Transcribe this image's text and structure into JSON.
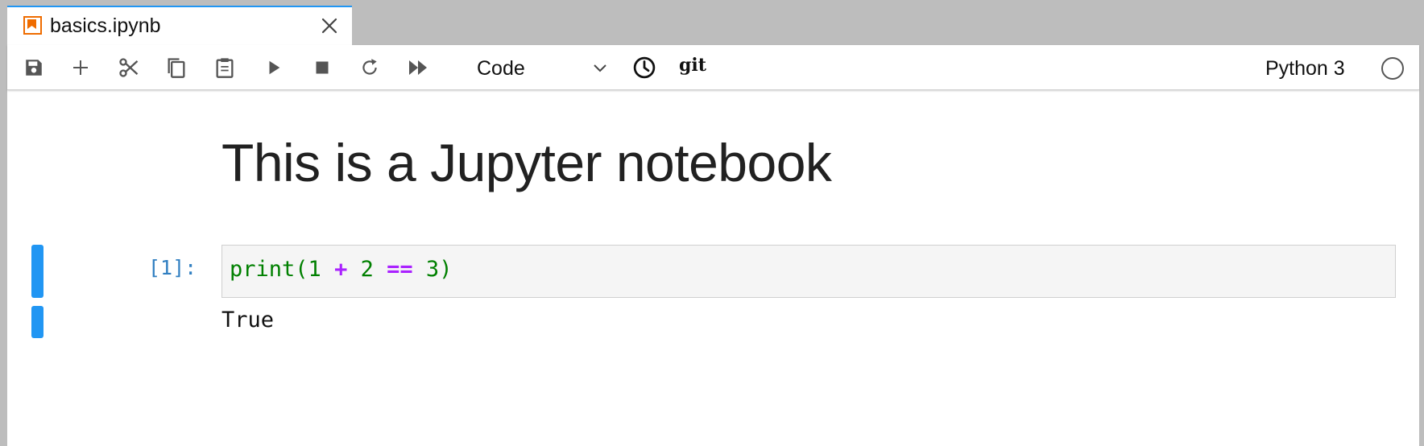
{
  "tab": {
    "title": "basics.ipynb",
    "icon": "notebook-icon",
    "accent": "#ef6c00"
  },
  "toolbar": {
    "buttons": [
      {
        "name": "save-icon"
      },
      {
        "name": "add-cell-icon"
      },
      {
        "name": "cut-icon"
      },
      {
        "name": "copy-icon"
      },
      {
        "name": "paste-icon"
      },
      {
        "name": "run-icon"
      },
      {
        "name": "stop-icon"
      },
      {
        "name": "restart-icon"
      },
      {
        "name": "run-all-icon"
      }
    ],
    "cell_type": "Code",
    "git_label": "git",
    "kernel_name": "Python 3",
    "kernel_status": "idle"
  },
  "notebook": {
    "heading": "This is a Jupyter notebook",
    "cells": [
      {
        "prompt": "[1]:",
        "code_tokens": [
          {
            "text": "print",
            "kind": "builtin"
          },
          {
            "text": "(",
            "kind": "punct"
          },
          {
            "text": "1",
            "kind": "num"
          },
          {
            "text": " ",
            "kind": "space"
          },
          {
            "text": "+",
            "kind": "op"
          },
          {
            "text": " ",
            "kind": "space"
          },
          {
            "text": "2",
            "kind": "num"
          },
          {
            "text": " ",
            "kind": "space"
          },
          {
            "text": "==",
            "kind": "op"
          },
          {
            "text": " ",
            "kind": "space"
          },
          {
            "text": "3",
            "kind": "num"
          },
          {
            "text": ")",
            "kind": "punct"
          }
        ],
        "output": "True"
      }
    ]
  },
  "colors": {
    "accent": "#2196f3",
    "prompt": "#307fc1",
    "code_green": "#008000",
    "code_operator": "#aa22ff"
  }
}
